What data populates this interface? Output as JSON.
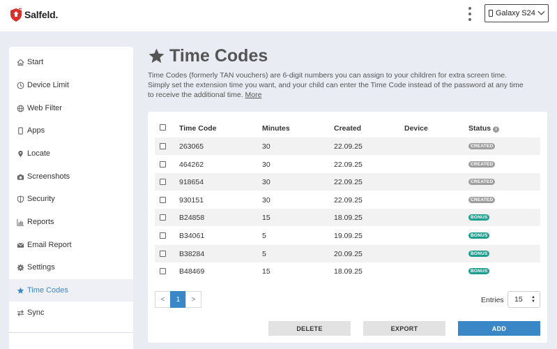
{
  "header": {
    "brand": "Salfeld.",
    "device": "Galaxy S24"
  },
  "colors": {
    "accent": "#3a87c8",
    "badge_created": "#9e9e9e",
    "badge_bonus": "#1f9e8f",
    "brand_red": "#d9302c"
  },
  "sidebar": {
    "items": [
      {
        "label": "Start",
        "icon": "home-icon"
      },
      {
        "label": "Device Limit",
        "icon": "clock-icon"
      },
      {
        "label": "Web Filter",
        "icon": "globe-icon"
      },
      {
        "label": "Apps",
        "icon": "mobile-icon"
      },
      {
        "label": "Locate",
        "icon": "map-pin-icon"
      },
      {
        "label": "Screenshots",
        "icon": "camera-icon"
      },
      {
        "label": "Security",
        "icon": "shield-icon"
      },
      {
        "label": "Reports",
        "icon": "chart-icon"
      },
      {
        "label": "Email Report",
        "icon": "envelope-icon"
      },
      {
        "label": "Settings",
        "icon": "gear-icon"
      },
      {
        "label": "Time Codes",
        "icon": "star-icon",
        "active": true
      },
      {
        "label": "Sync",
        "icon": "sync-icon"
      }
    ]
  },
  "main": {
    "title": "Time Codes",
    "intro": "Time Codes (formerly TAN vouchers) are 6-digit numbers you can assign to your children for extra screen time. Simply set the extension time you want, and your child can enter the Time Code instead of the password at any time to receive the additional time.",
    "more_link": "More",
    "table": {
      "columns": [
        "Time Code",
        "Minutes",
        "Created",
        "Device",
        "Status"
      ],
      "rows": [
        {
          "code": "263065",
          "minutes": "30",
          "created": "22.09.25",
          "device": "",
          "status": "CREATED"
        },
        {
          "code": "464262",
          "minutes": "30",
          "created": "22.09.25",
          "device": "",
          "status": "CREATED"
        },
        {
          "code": "918654",
          "minutes": "30",
          "created": "22.09.25",
          "device": "",
          "status": "CREATED"
        },
        {
          "code": "930151",
          "minutes": "30",
          "created": "22.09.25",
          "device": "",
          "status": "CREATED"
        },
        {
          "code": "B24858",
          "minutes": "15",
          "created": "18.09.25",
          "device": "",
          "status": "BONUS"
        },
        {
          "code": "B34061",
          "minutes": "5",
          "created": "19.09.25",
          "device": "",
          "status": "BONUS"
        },
        {
          "code": "B38284",
          "minutes": "5",
          "created": "20.09.25",
          "device": "",
          "status": "BONUS"
        },
        {
          "code": "B48469",
          "minutes": "15",
          "created": "18.09.25",
          "device": "",
          "status": "BONUS"
        }
      ]
    },
    "pagination": {
      "prev": "<",
      "current": "1",
      "next": ">"
    },
    "entries": {
      "label": "Entries",
      "value": "15"
    },
    "buttons": {
      "delete": "DELETE",
      "export": "EXPORT",
      "add": "ADD"
    }
  }
}
